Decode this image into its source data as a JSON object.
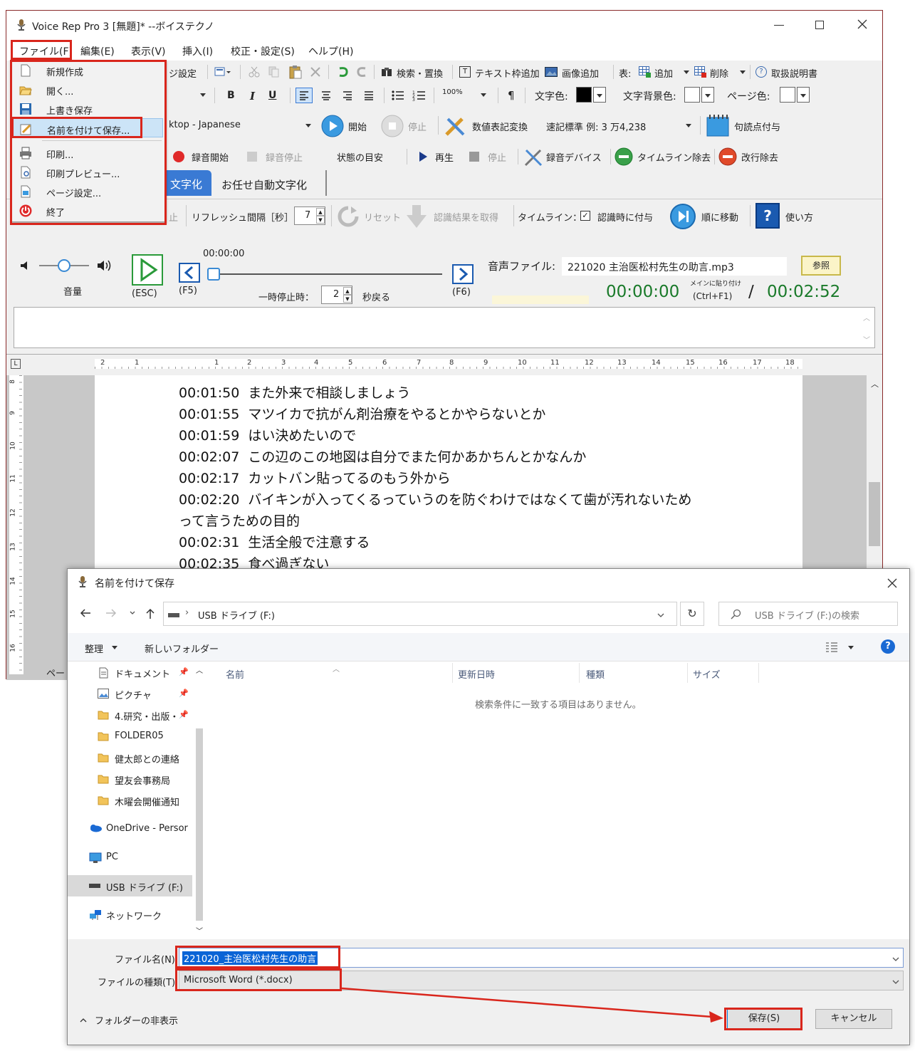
{
  "app": {
    "title": "Voice Rep Pro 3 [無題]* --ボイステクノ",
    "menubar": [
      "ファイル(F)",
      "編集(E)",
      "表示(V)",
      "挿入(I)",
      "校正・設定(S)",
      "ヘルプ(H)"
    ],
    "toolbar1": {
      "page_setup_partial": "ジ設定",
      "search_replace": "検索・置換",
      "add_textbox": "テキスト枠追加",
      "add_image": "画像追加",
      "table_label": "表:",
      "table_add": "追加",
      "table_delete": "削除",
      "manual": "取扱説明書"
    },
    "toolbar2": {
      "bold": "B",
      "italic": "I",
      "underline": "U",
      "zoom": "100%",
      "pilcrow": "¶",
      "text_color": "文字色:",
      "text_bg_color": "文字背景色:",
      "page_color": "ページ色:"
    },
    "toolbar3": {
      "engine_partial": "ktop - Japanese",
      "start": "開始",
      "stop": "停止",
      "numeric_convert": "数値表記変換",
      "notation": "速記標準 例: 3 万4,238",
      "punctuation": "句読点付与"
    },
    "toolbar4": {
      "rec_start": "録音開始",
      "rec_stop": "録音停止",
      "status_guide": "状態の目安",
      "play": "再生",
      "stop": "停止",
      "rec_device": "録音デバイス",
      "remove_timeline": "タイムライン除去",
      "remove_linebreak": "改行除去"
    },
    "tabs": [
      "文字化",
      "お任せ自動文字化"
    ],
    "toolbar5": {
      "stop_partial": "止",
      "refresh_label": "リフレッシュ間隔［秒］",
      "refresh_value": "7",
      "reset": "リセット",
      "get_result": "認識結果を取得",
      "timeline_label": "タイムライン：",
      "add_on_recog": "認識時に付与",
      "move_in_order": "順に移動",
      "how_to": "使い方"
    },
    "player": {
      "volume_label": "音量",
      "esc_label": "(ESC)",
      "f5_label": "(F5)",
      "f6_label": "(F6)",
      "time_marker": "00:00:00",
      "pause_label": "一時停止時：",
      "pause_value": "2",
      "rewind_label": "秒戻る",
      "audio_file_label": "音声ファイル:",
      "audio_file_name": "221020 主治医松村先生の助言.mp3",
      "browse": "参照",
      "current_time": "00:00:00",
      "paste_main": "メインに貼り付け",
      "paste_key": "(Ctrl+F1)",
      "slash": "/",
      "total_time": "00:02:52"
    },
    "ruler_numbers": [
      "2",
      "1",
      "1",
      "2",
      "3",
      "4",
      "5",
      "6",
      "7",
      "8",
      "9",
      "10",
      "11",
      "12",
      "13",
      "14",
      "15",
      "16",
      "17",
      "18"
    ],
    "vruler_numbers": [
      "8",
      "9",
      "10",
      "11",
      "12",
      "13",
      "14",
      "15",
      "16"
    ],
    "transcript": [
      {
        "time": "00:01:50",
        "text": "また外来で相談しましょう"
      },
      {
        "time": "00:01:55",
        "text": "マツイカで抗がん剤治療をやるとかやらないとか"
      },
      {
        "time": "00:01:59",
        "text": "はい決めたいので"
      },
      {
        "time": "00:02:07",
        "text": "この辺のこの地図は自分でまた何かあかちんとかなんか"
      },
      {
        "time": "00:02:17",
        "text": "カットバン貼ってるのもう外から"
      },
      {
        "time": "00:02:20",
        "text": "バイキンが入ってくるっていうのを防ぐわけではなくて歯が汚れないため"
      },
      {
        "time": "",
        "text": "って言うための目的"
      },
      {
        "time": "00:02:31",
        "text": "生活全般で注意する"
      },
      {
        "time": "00:02:35",
        "text": "食べ過ぎない"
      }
    ],
    "status_partial": "ペー"
  },
  "file_menu": {
    "items": [
      {
        "label": "新規作成",
        "icon": "new-document-icon"
      },
      {
        "label": "開く...",
        "icon": "open-folder-icon"
      },
      {
        "label": "上書き保存",
        "icon": "save-disk-icon"
      },
      {
        "label": "名前を付けて保存...",
        "icon": "save-as-icon"
      },
      {
        "label": "印刷...",
        "icon": "printer-icon"
      },
      {
        "label": "印刷プレビュー...",
        "icon": "print-preview-icon"
      },
      {
        "label": "ページ設定...",
        "icon": "page-setup-icon"
      },
      {
        "label": "終了",
        "icon": "power-icon"
      }
    ]
  },
  "save_dialog": {
    "title": "名前を付けて保存",
    "path": "USB ドライブ (F:)",
    "search_placeholder": "USB ドライブ (F:)の検索",
    "organize": "整理",
    "new_folder": "新しいフォルダー",
    "nav_items": [
      {
        "label": "ドキュメント",
        "icon": "documents-icon"
      },
      {
        "label": "ピクチャ",
        "icon": "pictures-icon"
      },
      {
        "label": "4.研究・出版・",
        "icon": "folder-icon"
      },
      {
        "label": "FOLDER05",
        "icon": "folder-icon"
      },
      {
        "label": "健太郎との連絡",
        "icon": "folder-icon"
      },
      {
        "label": "望友会事務局",
        "icon": "folder-icon"
      },
      {
        "label": "木曜会開催通知",
        "icon": "folder-icon"
      },
      {
        "label": "OneDrive - Persor",
        "icon": "onedrive-icon"
      },
      {
        "label": "PC",
        "icon": "pc-icon"
      },
      {
        "label": "USB ドライブ (F:)",
        "icon": "usb-drive-icon"
      },
      {
        "label": "ネットワーク",
        "icon": "network-icon"
      }
    ],
    "columns": [
      "名前",
      "更新日時",
      "種類",
      "サイズ"
    ],
    "empty_message": "検索条件に一致する項目はありません。",
    "filename_label": "ファイル名(N):",
    "filename_value": "221020_主治医松村先生の助言",
    "filetype_label": "ファイルの種類(T):",
    "filetype_value": "Microsoft Word (*.docx)",
    "hide_folders": "フォルダーの非表示",
    "save_button": "保存(S)",
    "cancel_button": "キャンセル"
  },
  "colors": {
    "highlight_red": "#d9261c",
    "accent_blue": "#2a7ad4",
    "time_green": "#1a7a2a",
    "selection_blue": "#0a64d6"
  }
}
